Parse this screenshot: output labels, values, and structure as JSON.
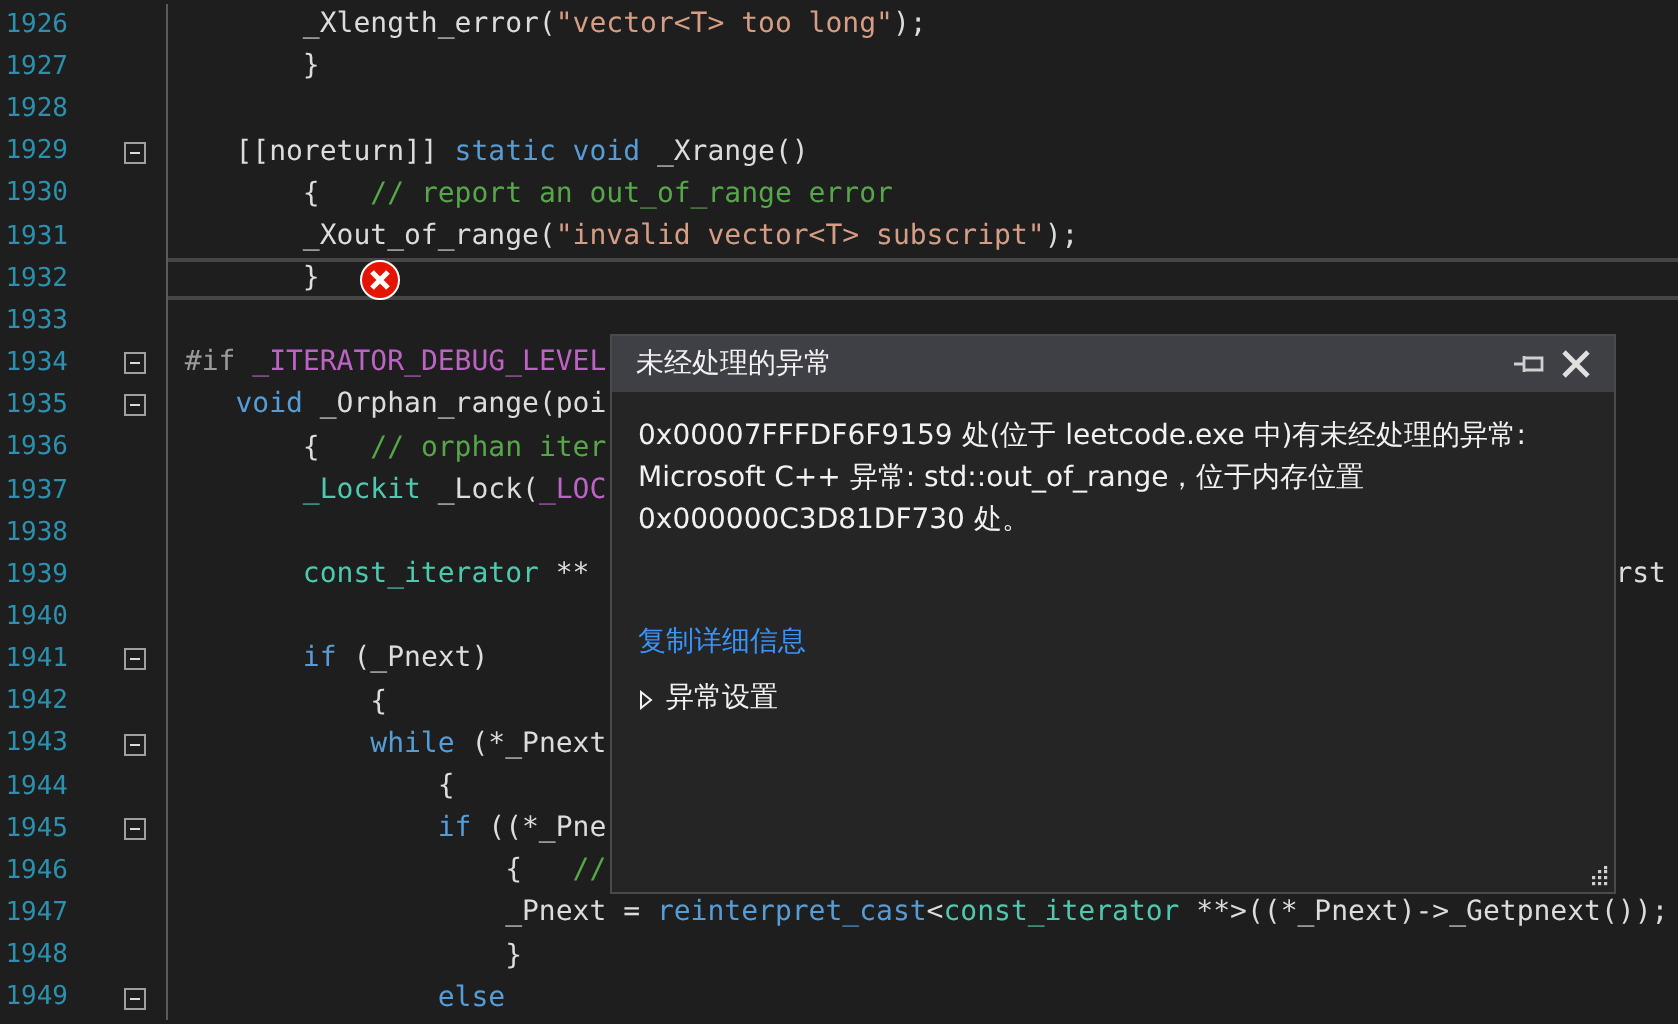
{
  "editor": {
    "lines": [
      {
        "number": "1926",
        "collapsible": false,
        "current": false,
        "error": false,
        "code": [
          {
            "text": "        _Xlength_error(",
            "kind": "plain"
          },
          {
            "text": "\"vector<T> too long\"",
            "kind": "string"
          },
          {
            "text": ");",
            "kind": "plain"
          }
        ]
      },
      {
        "number": "1927",
        "collapsible": false,
        "current": false,
        "error": false,
        "code": [
          {
            "text": "        }",
            "kind": "plain"
          }
        ]
      },
      {
        "number": "1928",
        "collapsible": false,
        "current": false,
        "error": false
      },
      {
        "number": "1929",
        "collapsible": true,
        "current": false,
        "error": false,
        "code": [
          {
            "text": "    [[noreturn]] ",
            "kind": "plain"
          },
          {
            "text": "static void",
            "kind": "keyword"
          },
          {
            "text": " _Xrange()",
            "kind": "plain"
          }
        ]
      },
      {
        "number": "1930",
        "collapsible": false,
        "current": false,
        "error": false,
        "code": [
          {
            "text": "        {   ",
            "kind": "plain"
          },
          {
            "text": "// report an out_of_range error",
            "kind": "comment"
          }
        ]
      },
      {
        "number": "1931",
        "collapsible": false,
        "current": false,
        "error": false,
        "code": [
          {
            "text": "        _Xout_of_range(",
            "kind": "plain"
          },
          {
            "text": "\"invalid vector<T> subscript\"",
            "kind": "string"
          },
          {
            "text": ");",
            "kind": "plain"
          }
        ]
      },
      {
        "number": "1932",
        "collapsible": false,
        "current": true,
        "error": true,
        "code": [
          {
            "text": "        }",
            "kind": "plain"
          }
        ]
      },
      {
        "number": "1933",
        "collapsible": false,
        "current": false,
        "error": false
      },
      {
        "number": "1934",
        "collapsible": true,
        "current": false,
        "error": false,
        "code": [
          {
            "text": " #if ",
            "kind": "preproc"
          },
          {
            "text": "_ITERATOR_DEBUG_LEVEL",
            "kind": "macro"
          }
        ]
      },
      {
        "number": "1935",
        "collapsible": true,
        "current": false,
        "error": false,
        "code": [
          {
            "text": "    void",
            "kind": "keyword"
          },
          {
            "text": " _Orphan_range(poi",
            "kind": "plain"
          }
        ]
      },
      {
        "number": "1936",
        "collapsible": false,
        "current": false,
        "error": false,
        "code": [
          {
            "text": "        {   ",
            "kind": "plain"
          },
          {
            "text": "// orphan iter",
            "kind": "comment"
          }
        ]
      },
      {
        "number": "1937",
        "collapsible": false,
        "current": false,
        "error": false,
        "code": [
          {
            "text": "        _Lockit",
            "kind": "type"
          },
          {
            "text": " _Lock(",
            "kind": "plain"
          },
          {
            "text": "_LOC",
            "kind": "macro"
          }
        ]
      },
      {
        "number": "1938",
        "collapsible": false,
        "current": false,
        "error": false
      },
      {
        "number": "1939",
        "collapsible": false,
        "current": false,
        "error": false,
        "code": [
          {
            "text": "        const_iterator",
            "kind": "type"
          },
          {
            "text": " **",
            "kind": "plain"
          }
        ],
        "tail": "rst"
      },
      {
        "number": "1940",
        "collapsible": false,
        "current": false,
        "error": false
      },
      {
        "number": "1941",
        "collapsible": true,
        "current": false,
        "error": false,
        "code": [
          {
            "text": "        if",
            "kind": "keyword"
          },
          {
            "text": " (_Pnext)",
            "kind": "plain"
          }
        ]
      },
      {
        "number": "1942",
        "collapsible": false,
        "current": false,
        "error": false,
        "code": [
          {
            "text": "            {",
            "kind": "plain"
          }
        ]
      },
      {
        "number": "1943",
        "collapsible": true,
        "current": false,
        "error": false,
        "code": [
          {
            "text": "            while",
            "kind": "keyword"
          },
          {
            "text": " (*_Pnext",
            "kind": "plain"
          }
        ]
      },
      {
        "number": "1944",
        "collapsible": false,
        "current": false,
        "error": false,
        "code": [
          {
            "text": "                {",
            "kind": "plain"
          }
        ]
      },
      {
        "number": "1945",
        "collapsible": true,
        "current": false,
        "error": false,
        "code": [
          {
            "text": "                if",
            "kind": "keyword"
          },
          {
            "text": " ((*_Pne",
            "kind": "plain"
          }
        ]
      },
      {
        "number": "1946",
        "collapsible": false,
        "current": false,
        "error": false,
        "code": [
          {
            "text": "                    {   ",
            "kind": "plain"
          },
          {
            "text": "//",
            "kind": "comment"
          }
        ]
      },
      {
        "number": "1947",
        "collapsible": false,
        "current": false,
        "error": false,
        "code": [
          {
            "text": "                    _Pnext = ",
            "kind": "plain"
          },
          {
            "text": "reinterpret_cast",
            "kind": "keyword"
          },
          {
            "text": "<",
            "kind": "plain"
          },
          {
            "text": "const_iterator",
            "kind": "type"
          },
          {
            "text": " **>((*_Pnext)->_Getpnext());",
            "kind": "plain"
          }
        ]
      },
      {
        "number": "1948",
        "collapsible": false,
        "current": false,
        "error": false,
        "code": [
          {
            "text": "                    }",
            "kind": "plain"
          }
        ]
      },
      {
        "number": "1949",
        "collapsible": true,
        "current": false,
        "error": false,
        "code": [
          {
            "text": "                else",
            "kind": "keyword"
          }
        ]
      }
    ]
  },
  "exception_popup": {
    "title": "未经处理的异常",
    "message": "0x00007FFFDF6F9159 处(位于 leetcode.exe 中)有未经处理的异常: Microsoft C++ 异常: std::out_of_range，位于内存位置 0x000000C3D81DF730 处。",
    "copy_details_link": "复制详细信息",
    "settings": {
      "label": "异常设置",
      "expanded": false
    }
  }
}
